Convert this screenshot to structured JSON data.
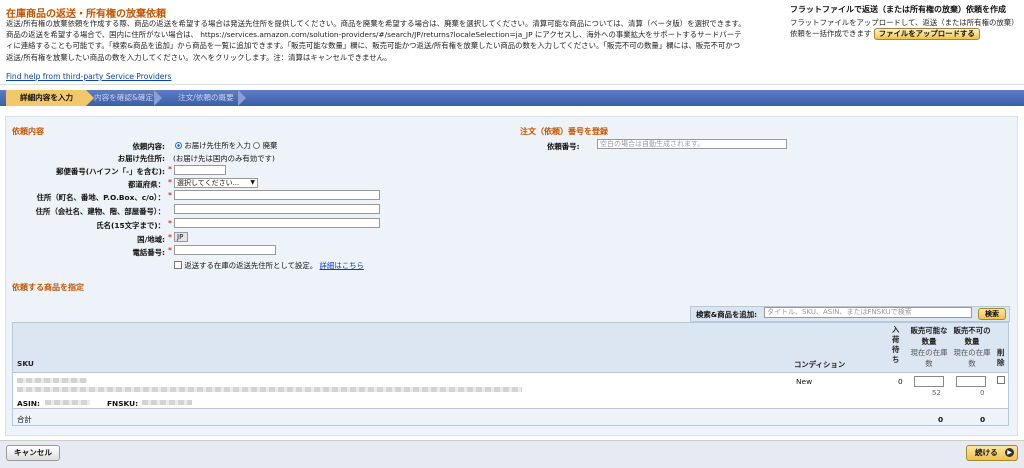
{
  "header": {
    "title": "在庫商品の返送・所有権の放棄依頼",
    "description": "返送/所有権の放棄依頼を作成する際、商品の返送を希望する場合は発送先住所を提供してください。商品を廃棄を希望する場合は、廃棄を選択してください。清算可能な商品については、清算（ベータ版）を選択できます。商品の返送を希望する場合で、国内に住所がない場合は、 https://services.amazon.com/solution-providers/#/search/JP/returns?localeSelection=ja_JP にアクセスし、海外への事業拡大をサポートするサードパーティに連絡することも可能です。「検索&商品を追加」から商品を一覧に追加できます。「販売可能な数量」欄に、販売可能かつ返送/所有権を放棄したい商品の数を入力してください。「販売不可の数量」欄には、販売不可かつ返送/所有権を放棄したい商品の数を入力してください。次へをクリックします。注：清算はキャンセルできません。",
    "help_link": "Find help from third-party Service Providers"
  },
  "flatfile": {
    "title": "フラットファイルで返送（または所有権の放棄）依頼を作成",
    "desc": "フラットファイルをアップロードして、返送（または所有権の放棄）依頼を一括作成できます",
    "upload_button": "ファイルをアップロードする"
  },
  "steps": [
    "詳細内容を入力",
    "内容を確認&確定",
    "注文/依頼の概要"
  ],
  "form": {
    "section_title": "依頼内容",
    "request_type_label": "依頼内容:",
    "option_ship": "お届け先住所を入力",
    "option_dispose": "廃棄",
    "ship_to_label": "お届け先住所:",
    "ship_to_note": "(お届け先は国内のみ有効です)",
    "postal_label": "郵便番号(ハイフン「-」を含む):",
    "prefecture_label": "都道府県：",
    "prefecture_value": "選択してください...",
    "address1_label": "住所（町名、番地、P.O.Box、c/o）：",
    "address2_label": "住所（会社名、建物、階、部屋番号）：",
    "name_label": "氏名(15文字まで)：",
    "country_label": "国/地域:",
    "country_value": "JP",
    "phone_label": "電話番号:",
    "default_checkbox_label": "返送する在庫の返送先住所として設定。",
    "details_link": "詳細はこちら",
    "required_mark": "*"
  },
  "order": {
    "section_title": "注文（依頼）番号を登録",
    "id_label": "依頼番号:",
    "id_placeholder": "空白の場合は自動生成されます。"
  },
  "products": {
    "section_title": "依頼する商品を指定",
    "search_label": "検索&商品を追加:",
    "search_placeholder": "タイトル、SKU、ASIN、またはFNSKUで検索",
    "search_button": "検索",
    "columns": {
      "sku": "SKU",
      "condition": "コンディション",
      "inbound": "入荷待ち",
      "sellable": "販売可能な数量",
      "sellable_sub": "現在の在庫数",
      "unsellable": "販売不可の数量",
      "unsellable_sub": "現在の在庫数",
      "remove": "削除"
    },
    "row": {
      "asin_label": "ASIN:",
      "fnsku_label": "FNSKU:",
      "condition": "New",
      "inbound": "0",
      "sellable_stock": "52",
      "unsellable_stock": "0"
    },
    "total_label": "合計",
    "total_sellable": "0",
    "total_unsellable": "0"
  },
  "footer": {
    "cancel": "キャンセル",
    "continue": "続ける"
  }
}
